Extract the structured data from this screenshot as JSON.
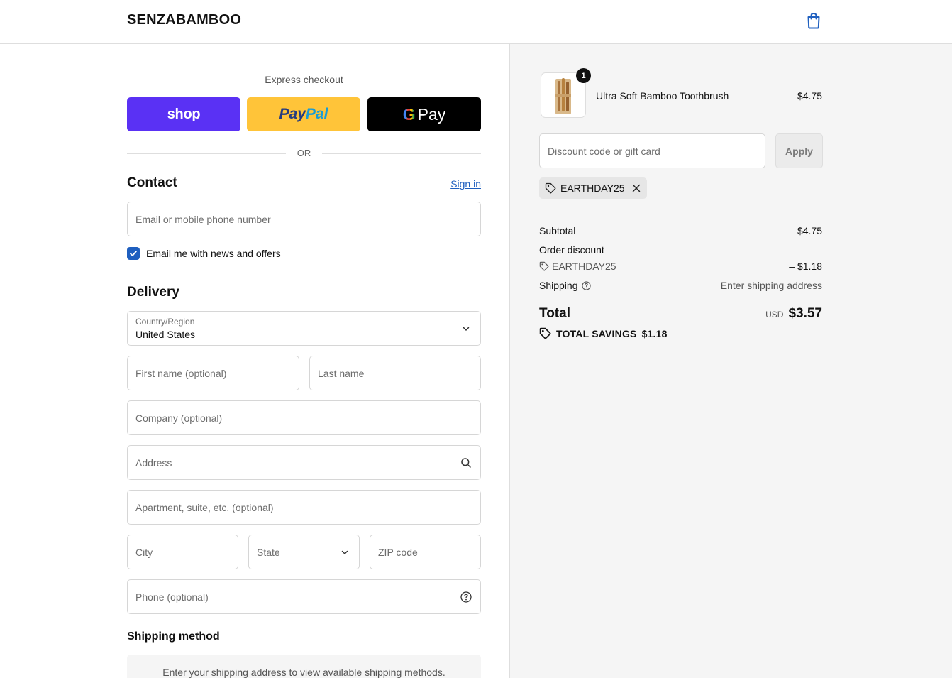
{
  "header": {
    "logo": "SENZABAMBOO",
    "cart_icon": "shopping-bag-icon"
  },
  "express": {
    "title": "Express checkout",
    "shop_label": "shop",
    "paypal_label_1": "Pay",
    "paypal_label_2": "Pal",
    "gpay_g": "G",
    "gpay_label": "Pay",
    "or_label": "OR"
  },
  "contact": {
    "title": "Contact",
    "signin_label": "Sign in",
    "email_placeholder": "Email or mobile phone number",
    "newsletter_label": "Email me with news and offers",
    "newsletter_checked": true
  },
  "delivery": {
    "title": "Delivery",
    "country_label": "Country/Region",
    "country_value": "United States",
    "first_name_placeholder": "First name (optional)",
    "last_name_placeholder": "Last name",
    "company_placeholder": "Company (optional)",
    "address_placeholder": "Address",
    "apartment_placeholder": "Apartment, suite, etc. (optional)",
    "city_placeholder": "City",
    "state_placeholder": "State",
    "zip_placeholder": "ZIP code",
    "phone_placeholder": "Phone (optional)"
  },
  "shipping_method": {
    "title": "Shipping method",
    "note": "Enter your shipping address to view available shipping methods."
  },
  "summary": {
    "product": {
      "name": "Ultra Soft Bamboo Toothbrush",
      "price": "$4.75",
      "quantity": "1"
    },
    "discount_placeholder": "Discount code or gift card",
    "apply_label": "Apply",
    "applied_code": "EARTHDAY25",
    "subtotal_label": "Subtotal",
    "subtotal_value": "$4.75",
    "order_discount_label": "Order discount",
    "order_discount_code": "EARTHDAY25",
    "order_discount_value": "– $1.18",
    "shipping_label": "Shipping",
    "shipping_value": "Enter shipping address",
    "total_label": "Total",
    "total_currency": "USD",
    "total_value": "$3.57",
    "savings_label": "TOTAL SAVINGS",
    "savings_value": "$1.18"
  },
  "colors": {
    "shop": "#5a31f4",
    "paypal": "#ffc439",
    "gpay": "#000000",
    "link": "#1f5fbf",
    "summary_bg": "#f5f5f5"
  }
}
